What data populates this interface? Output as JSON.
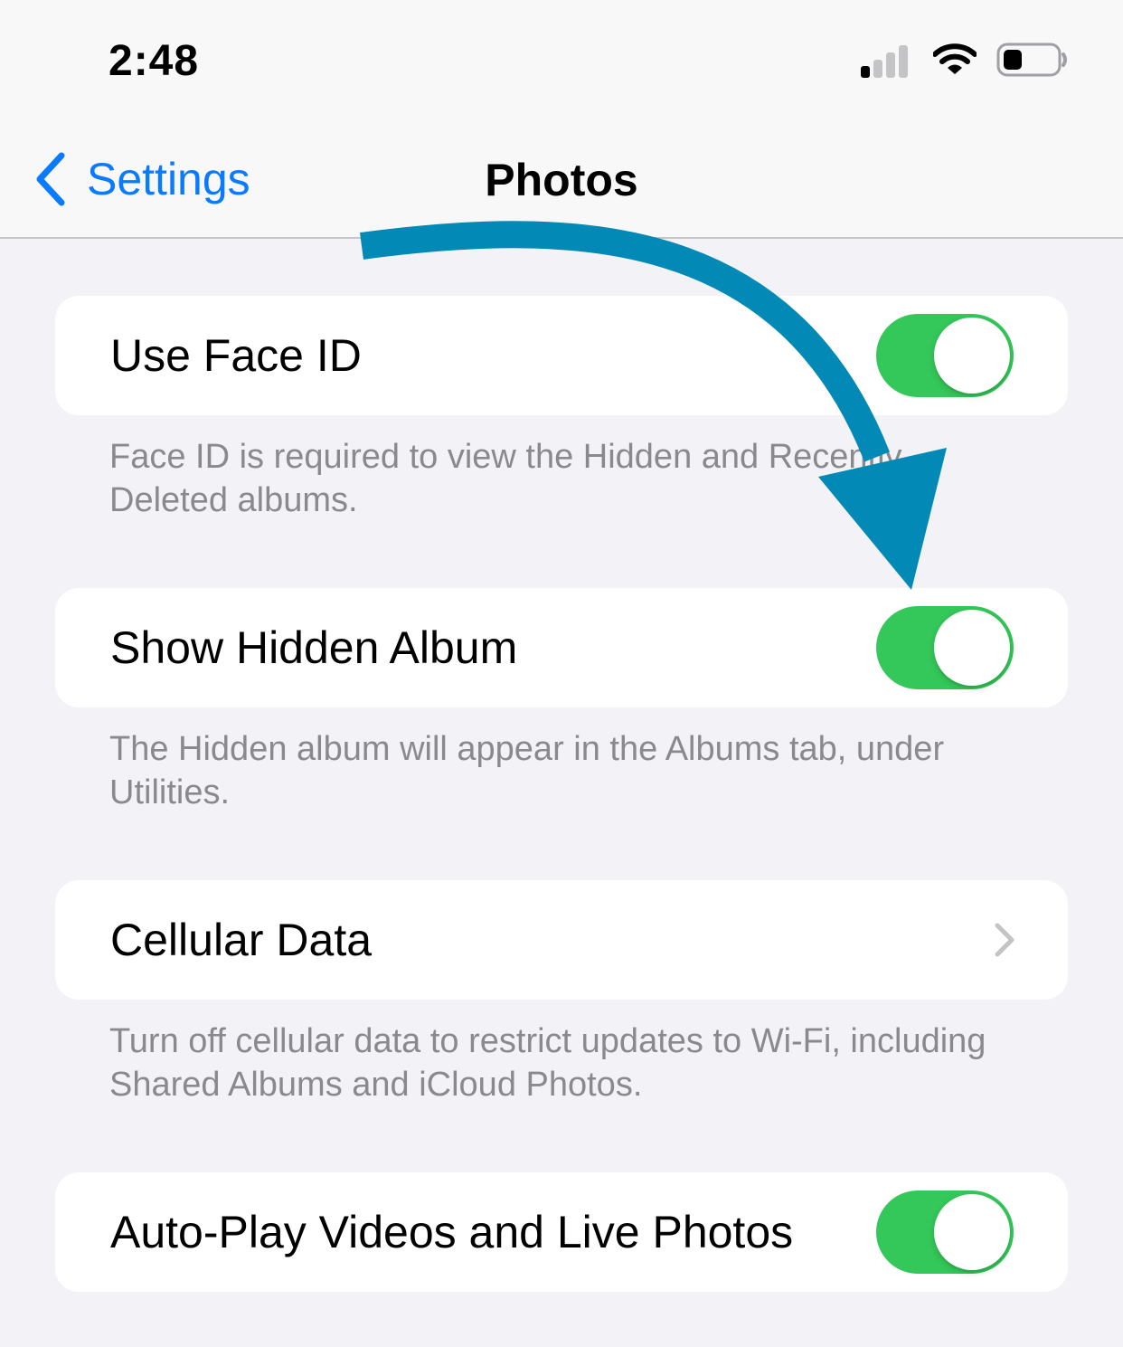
{
  "status_bar": {
    "time": "2:48",
    "signal_icon": "cellular-signal-icon",
    "wifi_icon": "wifi-icon",
    "battery_icon": "battery-icon",
    "battery_level": 0.35
  },
  "nav": {
    "back_label": "Settings",
    "title": "Photos"
  },
  "settings": {
    "use_face_id": {
      "label": "Use Face ID",
      "on": true,
      "footer": "Face ID is required to view the Hidden and Recently Deleted albums."
    },
    "show_hidden_album": {
      "label": "Show Hidden Album",
      "on": true,
      "footer": "The Hidden album will appear in the Albums tab, under Utilities."
    },
    "cellular_data": {
      "label": "Cellular Data",
      "footer": "Turn off cellular data to restrict updates to Wi-Fi, including Shared Albums and iCloud Photos."
    },
    "auto_play": {
      "label": "Auto-Play Videos and Live Photos",
      "on": true
    }
  },
  "colors": {
    "accent": "#0a7aff",
    "toggle_on": "#34c759",
    "annotation_arrow": "#0289b6",
    "background": "#f2f2f7",
    "footer_text": "#8a8a8e"
  }
}
